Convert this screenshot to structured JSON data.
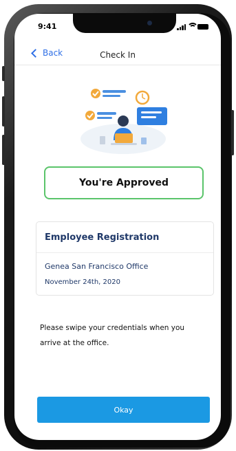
{
  "status_bar": {
    "time": "9:41"
  },
  "nav": {
    "back_label": "Back",
    "title": "Check In"
  },
  "approval": {
    "label": "You're Approved",
    "accent_color": "#5ac46a"
  },
  "registration": {
    "title": "Employee Registration",
    "location": "Genea San Francisco Office",
    "date": "November 24th, 2020"
  },
  "instructions": "Please swipe your credentials when you arrive at the office.",
  "actions": {
    "okay_label": "Okay",
    "primary_color": "#1b99e3"
  },
  "icons": [
    "chevron-left-icon",
    "signal-icon",
    "wifi-icon",
    "battery-icon",
    "check-in-illustration"
  ]
}
